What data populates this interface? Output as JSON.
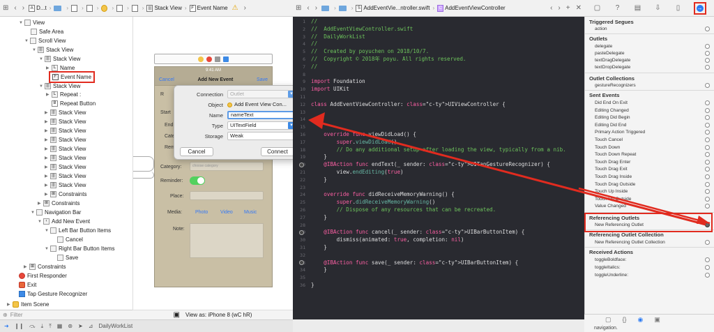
{
  "colors": {
    "annotation_red": "#e12b1f",
    "code_bg": "#292a30",
    "comment": "#6dc35c",
    "keyword": "#fc5fa3",
    "type": "#d0a8ff",
    "accent": "#2b7bf3"
  },
  "left_jumpbar": {
    "crumbs": [
      "D...t",
      "",
      "",
      "",
      "",
      "Stack View",
      "Event Name"
    ]
  },
  "editor_jumpbar": {
    "file": "AddEventVie...ntroller.swift",
    "class": "AddEventViewController"
  },
  "outline": {
    "rows": [
      {
        "label": "View"
      },
      {
        "label": "Safe Area"
      },
      {
        "label": "Scroll View"
      },
      {
        "label": "Stack View"
      },
      {
        "label": "Stack View"
      },
      {
        "label": "Name"
      },
      {
        "label": "Event Name"
      },
      {
        "label": "Stack View"
      },
      {
        "label": "Repeat :"
      },
      {
        "label": "Repeat Button"
      },
      {
        "label": "Stack View"
      },
      {
        "label": "Stack View"
      },
      {
        "label": "Stack View"
      },
      {
        "label": "Stack View"
      },
      {
        "label": "Stack View"
      },
      {
        "label": "Stack View"
      },
      {
        "label": "Stack View"
      },
      {
        "label": "Stack View"
      },
      {
        "label": "Stack View"
      },
      {
        "label": "Constraints"
      },
      {
        "label": "Constraints"
      },
      {
        "label": "Navigation Bar"
      },
      {
        "label": "Add New Event"
      },
      {
        "label": "Left Bar Button Items"
      },
      {
        "label": "Cancel"
      },
      {
        "label": "Right Bar Button Items"
      },
      {
        "label": "Save"
      },
      {
        "label": "Constraints"
      },
      {
        "label": "First Responder"
      },
      {
        "label": "Exit"
      },
      {
        "label": "Tap Gesture Recognizer"
      },
      {
        "label": "Item Scene"
      }
    ],
    "filter_placeholder": "Filter"
  },
  "device": {
    "time": "9:41 AM",
    "nav_title": "Add New Event",
    "cancel": "Cancel",
    "save": "Save",
    "partial_labels": [
      "R",
      "Start",
      "End",
      "Cate",
      "Rem"
    ],
    "category_label": "Category:",
    "category_placeholder": "choose category",
    "reminder_label": "Reminder:",
    "place_label": "Place:",
    "media_label": "Media:",
    "media_options": [
      "Photo",
      "Video",
      "Music"
    ],
    "note_label": "Note:"
  },
  "canvas": {
    "view_as": "View as: iPhone 8 (wC hR)"
  },
  "popover": {
    "connection_label": "Connection",
    "connection_value": "Outlet",
    "object_label": "Object",
    "object_value": "Add Event View Con...",
    "name_label": "Name",
    "name_value": "nameText",
    "type_label": "Type",
    "type_value": "UITextField",
    "storage_label": "Storage",
    "storage_value": "Weak",
    "cancel": "Cancel",
    "connect": "Connect"
  },
  "code": [
    {
      "n": "1",
      "t": "//"
    },
    {
      "n": "2",
      "t": "//  AddEventViewController.swift"
    },
    {
      "n": "3",
      "t": "//  DailyWorkList"
    },
    {
      "n": "4",
      "t": "//"
    },
    {
      "n": "5",
      "t": "//  Created by poyuchen on 2018/10/7."
    },
    {
      "n": "6",
      "t": "//  Copyright © 2018年 poyu. All rights reserved."
    },
    {
      "n": "7",
      "t": "//"
    },
    {
      "n": "8",
      "t": ""
    },
    {
      "n": "9",
      "t": "import Foundation"
    },
    {
      "n": "10",
      "t": "import UIKit"
    },
    {
      "n": "11",
      "t": ""
    },
    {
      "n": "12",
      "t": "class AddEventViewController: UIViewController {"
    },
    {
      "n": "13",
      "t": ""
    },
    {
      "n": "14",
      "t": ""
    },
    {
      "n": "15",
      "t": ""
    },
    {
      "n": "16",
      "t": "    override func viewDidLoad() {"
    },
    {
      "n": "17",
      "t": "        super.viewDidLoad()"
    },
    {
      "n": "18",
      "t": "        // Do any additional setup after loading the view, typically from a nib."
    },
    {
      "n": "19",
      "t": "    }"
    },
    {
      "n": "20",
      "t": "    @IBAction func endText(_ sender: UITapGestureRecognizer) {"
    },
    {
      "n": "21",
      "t": "        view.endEditing(true)"
    },
    {
      "n": "22",
      "t": "    }"
    },
    {
      "n": "23",
      "t": ""
    },
    {
      "n": "24",
      "t": "    override func didReceiveMemoryWarning() {"
    },
    {
      "n": "25",
      "t": "        super.didReceiveMemoryWarning()"
    },
    {
      "n": "26",
      "t": "        // Dispose of any resources that can be recreated."
    },
    {
      "n": "27",
      "t": "    }"
    },
    {
      "n": "28",
      "t": ""
    },
    {
      "n": "29",
      "t": "    @IBAction func cancel(_ sender: UIBarButtonItem) {"
    },
    {
      "n": "30",
      "t": "        dismiss(animated: true, completion: nil)"
    },
    {
      "n": "31",
      "t": "    }"
    },
    {
      "n": "32",
      "t": ""
    },
    {
      "n": "33",
      "t": "    @IBAction func save(_ sender: UIBarButtonItem) {"
    },
    {
      "n": "34",
      "t": "    }"
    },
    {
      "n": "35",
      "t": ""
    },
    {
      "n": "36",
      "t": "}"
    }
  ],
  "inspector": {
    "triggered_segues": {
      "title": "Triggered Segues",
      "items": [
        "action"
      ]
    },
    "outlets": {
      "title": "Outlets",
      "items": [
        "delegate",
        "pasteDelegate",
        "textDragDelegate",
        "textDropDelegate"
      ]
    },
    "outlet_collections": {
      "title": "Outlet Collections",
      "items": [
        "gestureRecognizers"
      ]
    },
    "sent_events": {
      "title": "Sent Events",
      "items": [
        "Did End On Exit",
        "Editing Changed",
        "Editing Did Begin",
        "Editing Did End",
        "Primary Action Triggered",
        "Touch Cancel",
        "Touch Down",
        "Touch Down Repeat",
        "Touch Drag Enter",
        "Touch Drag Exit",
        "Touch Drag Inside",
        "Touch Drag Outside",
        "Touch Up Inside",
        "Touch Up Outside",
        "Value Changed"
      ]
    },
    "referencing_outlets": {
      "title": "Referencing Outlets",
      "items": [
        "New Referencing Outlet"
      ]
    },
    "referencing_collections": {
      "title": "Referencing Outlet Collection",
      "items": [
        "New Referencing Outlet Collection"
      ]
    },
    "received_actions": {
      "title": "Received Actions",
      "items": [
        "toggleBoldface:",
        "toggleItalics:",
        "toggleUnderline:"
      ]
    },
    "snippet": "navigation."
  },
  "debug": {
    "target": "DailyWorkList"
  }
}
